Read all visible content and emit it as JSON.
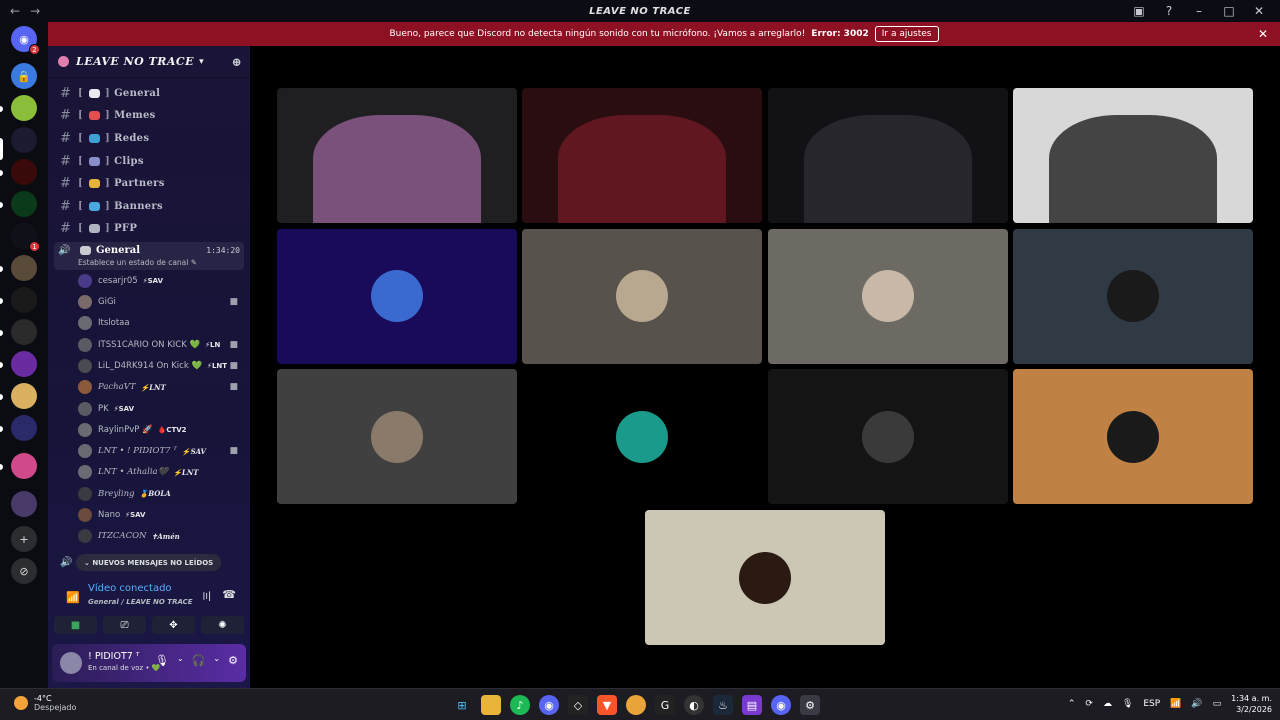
{
  "titlebar": {
    "title": "LEAVE NO TRACE"
  },
  "banner": {
    "message": "Bueno, parece que Discord no detecta ningún sonido con tu micrófono. ¡Vamos a arreglarlo!",
    "error": "Error: 3002",
    "button": "Ir a ajustes"
  },
  "rail": {
    "badges": [
      "2",
      "1"
    ]
  },
  "server": {
    "name": "LEAVE NO TRACE",
    "channels": [
      {
        "name": "General",
        "color": "#e8e8ee"
      },
      {
        "name": "Memes",
        "color": "#e05050"
      },
      {
        "name": "Redes",
        "color": "#3fa0d6"
      },
      {
        "name": "Clips",
        "color": "#8a8fcc"
      },
      {
        "name": "Partners",
        "color": "#e6b33a"
      },
      {
        "name": "Banners",
        "color": "#4aa8e0"
      },
      {
        "name": "PFP",
        "color": "#b0b4c0"
      }
    ],
    "voice_channel": {
      "name": "General",
      "time": "1:34:20",
      "status": "Establece un estado de canal"
    },
    "members": [
      {
        "name": "cesarjr05",
        "tag": "⚡SAV",
        "color": "#4a3b8a"
      },
      {
        "name": "GiGi",
        "tag": "",
        "color": "#7a6a6a"
      },
      {
        "name": "Itslotaa",
        "tag": "",
        "color": "#6a6a72"
      },
      {
        "name": "ITSS1CARIO ON KICK 💚",
        "tag": "⚡LN",
        "color": "#5a5a62"
      },
      {
        "name": "LiL_D4RK914 On Kick 💚",
        "tag": "⚡LNT",
        "color": "#4a4a52"
      },
      {
        "name": "PachaVT",
        "tag": "⚡LNT",
        "color": "#8a5a3a"
      },
      {
        "name": "PK",
        "tag": "⚡SAV",
        "color": "#5a5a62"
      },
      {
        "name": "RaylinPvP 🚀",
        "tag": "🩸CTV2",
        "color": "#6a6a72"
      },
      {
        "name": "LNT • ! PIDIOT7 ᵀ",
        "tag": "⚡SAV",
        "color": "#6a6a72"
      },
      {
        "name": "LNT • Athalia🖤",
        "tag": "⚡LNT",
        "color": "#6a6a72"
      },
      {
        "name": "Breyling",
        "tag": "🏅BOLA",
        "color": "#3a3a42"
      },
      {
        "name": "Nano",
        "tag": "⚡SAV",
        "color": "#6a4a3a"
      },
      {
        "name": "ITZCACON",
        "tag": "✝Amén",
        "color": "#3a3a42"
      }
    ],
    "unread": "NUEVOS MENSAJES NO LEÍDOS"
  },
  "voice_panel": {
    "status": "Vídeo conectado",
    "location": "General / LEAVE NO TRACE"
  },
  "user": {
    "name": "! PIDIOT7 ᵀ",
    "status": "En canal de voz • 💚"
  },
  "tiles": [
    {
      "bg": "#1f1f22",
      "kind": "video",
      "tone": "#8a5a8a"
    },
    {
      "bg": "#2a0d10",
      "kind": "video",
      "tone": "#6a1a22"
    },
    {
      "bg": "#121216",
      "kind": "video",
      "tone": "#2a2a30"
    },
    {
      "bg": "#d8d8d8",
      "kind": "video",
      "tone": "#2a2a2a"
    },
    {
      "bg": "#1a0a5a",
      "kind": "avatar",
      "avatar": "#3a6ad0"
    },
    {
      "bg": "#57534c",
      "kind": "avatar",
      "avatar": "#b8a890"
    },
    {
      "bg": "#6d6a64",
      "kind": "avatar",
      "avatar": "#c8b8a8"
    },
    {
      "bg": "#2f3a44",
      "kind": "avatar",
      "avatar": "#1a1a1a"
    },
    {
      "bg": "#404040",
      "kind": "avatar",
      "avatar": "#8a7a6a"
    },
    {
      "bg": "#000000",
      "kind": "avatar",
      "avatar": "#1a9a8a"
    },
    {
      "bg": "#141414",
      "kind": "avatar",
      "avatar": "#3a3a3a"
    },
    {
      "bg": "#c08244",
      "kind": "avatar",
      "avatar": "#1a1a1a"
    },
    {
      "bg": "#ccc6b4",
      "kind": "avatar",
      "avatar": "#2a1a12"
    }
  ],
  "taskbar": {
    "temp": "-4°C",
    "weather": "Despejado",
    "lang": "ESP",
    "time": "1:34 a. m.",
    "date": "3/2/2026"
  }
}
